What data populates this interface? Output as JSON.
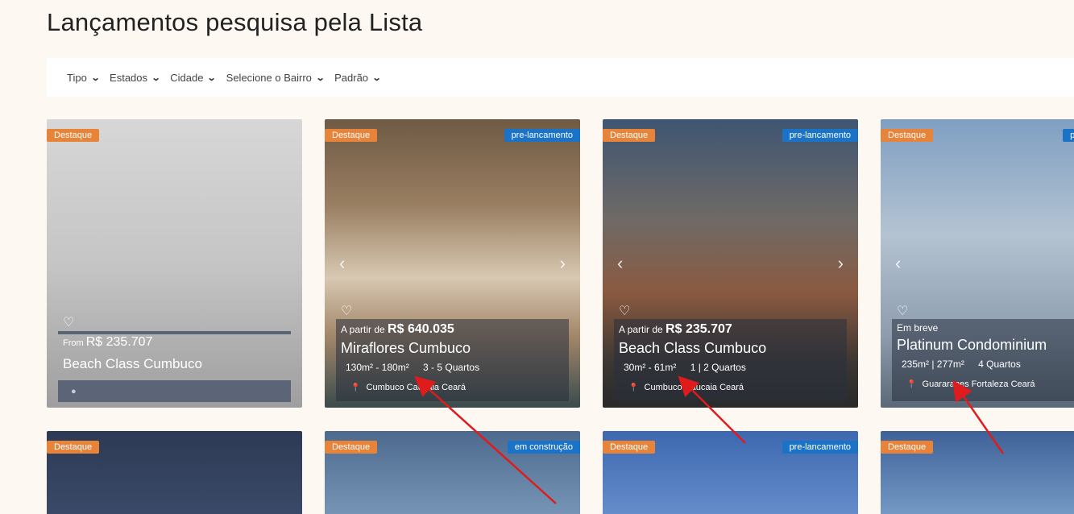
{
  "page": {
    "title": "Lançamentos pesquisa pela Lista"
  },
  "filters": [
    {
      "label": "Tipo"
    },
    {
      "label": "Estados"
    },
    {
      "label": "Cidade"
    },
    {
      "label": "Selecione o Bairro"
    },
    {
      "label": "Padrão"
    }
  ],
  "icons": {
    "chevron": "chevron-down-icon",
    "heart": "heart-icon",
    "pin": "map-pin-icon"
  },
  "colors": {
    "destaque": "#e8843a",
    "status": "#1a73c7",
    "background": "#fdf8f1"
  },
  "cards": [
    {
      "badge": "Destaque",
      "status": "",
      "price_prefix": "From",
      "price": "R$ 235.707",
      "title": "Beach Class Cumbuco"
    },
    {
      "badge": "Destaque",
      "status": "pre-lancamento",
      "price_prefix": "A partir de",
      "price": "R$ 640.035",
      "title": "Miraflores Cumbuco",
      "area": "130m² - 180m²",
      "rooms": "3 - 5 Quartos",
      "location": "Cumbuco  Caucaia  Ceará"
    },
    {
      "badge": "Destaque",
      "status": "pre-lancamento",
      "price_prefix": "A partir de",
      "price": "R$ 235.707",
      "title": "Beach Class Cumbuco",
      "area": "30m² - 61m²",
      "rooms": "1 | 2 Quartos",
      "location": "Cumbuco  Caucaia  Ceará"
    },
    {
      "badge": "Destaque",
      "status": "pre",
      "price_prefix": "Em breve",
      "title": "Platinum Condominium",
      "area": "235m² | 277m²",
      "rooms": "4 Quartos",
      "location": "Guararapes  Fortaleza  Ceará"
    }
  ],
  "row2": [
    {
      "badge": "Destaque",
      "status": ""
    },
    {
      "badge": "Destaque",
      "status": "em construção"
    },
    {
      "badge": "Destaque",
      "status": "pre-lancamento"
    },
    {
      "badge": "Destaque",
      "status": ""
    }
  ]
}
